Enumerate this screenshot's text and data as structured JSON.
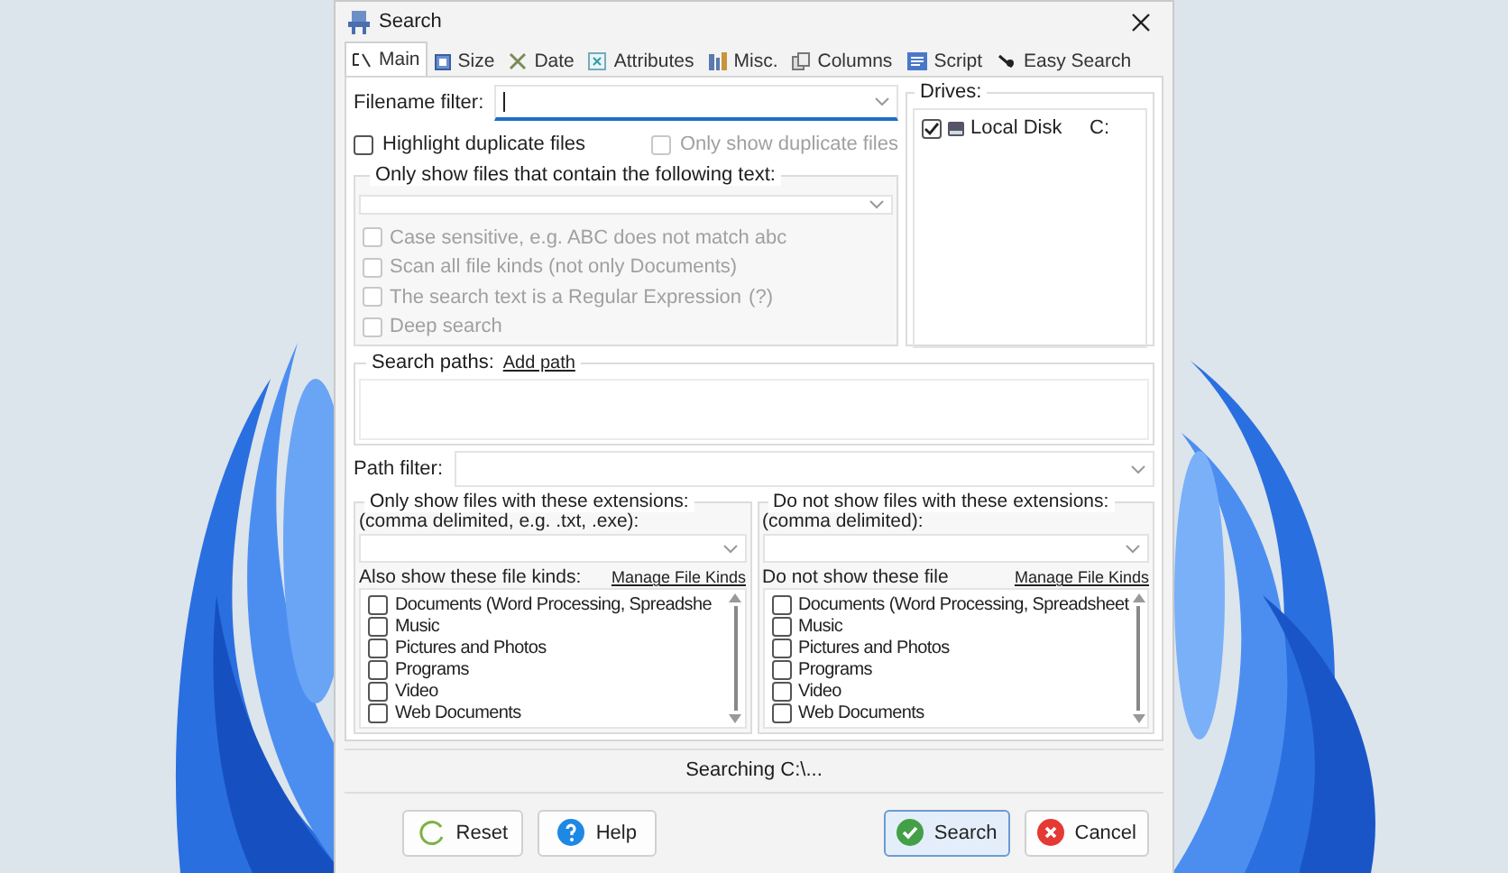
{
  "window": {
    "title": "Search"
  },
  "tabs": [
    {
      "label": "Main",
      "selected": true
    },
    {
      "label": "Size",
      "selected": false
    },
    {
      "label": "Date",
      "selected": false
    },
    {
      "label": "Attributes",
      "selected": false
    },
    {
      "label": "Misc.",
      "selected": false
    },
    {
      "label": "Columns",
      "selected": false
    },
    {
      "label": "Script",
      "selected": false
    },
    {
      "label": "Easy Search",
      "selected": false
    }
  ],
  "filename_filter": {
    "label": "Filename filter:",
    "focused": true
  },
  "duplicates": [
    {
      "label": "Highlight duplicate files",
      "checked": false,
      "disabled": false
    },
    {
      "label": "Only show duplicate files",
      "checked": false,
      "disabled": true
    }
  ],
  "text_group": {
    "title": "Only show files that contain the following text:",
    "options": [
      {
        "label": "Case sensitive, e.g. ABC does not match abc",
        "checked": false,
        "disabled": true
      },
      {
        "label": "Scan all file kinds (not only Documents)",
        "checked": false,
        "disabled": true
      },
      {
        "label": "The search text is a Regular Expression",
        "help": "(?)",
        "checked": false,
        "disabled": true
      },
      {
        "label": "Deep search",
        "checked": false,
        "disabled": true
      }
    ]
  },
  "drives": {
    "title": "Drives:",
    "items": [
      {
        "name": "Local Disk",
        "letter": "C:",
        "checked": true
      }
    ]
  },
  "search_paths": {
    "title": "Search paths:",
    "link": "Add path"
  },
  "path_filter": {
    "label": "Path filter:"
  },
  "extension_panels": [
    {
      "title": "Only show files with these extensions:",
      "hint": "(comma delimited, e.g. .txt, .exe):",
      "kinds_label": "Also show these file kinds:",
      "link": "Manage File Kinds",
      "kinds": [
        {
          "label": "Documents (Word Processing, Spreadshe",
          "checked": false
        },
        {
          "label": "Music",
          "checked": false
        },
        {
          "label": "Pictures and Photos",
          "checked": false
        },
        {
          "label": "Programs",
          "checked": false
        },
        {
          "label": "Video",
          "checked": false
        },
        {
          "label": "Web Documents",
          "checked": false
        }
      ]
    },
    {
      "title": "Do not show files with these extensions:",
      "hint": "(comma delimited):",
      "kinds_label": "Do not show these file",
      "link": "Manage File Kinds",
      "kinds": [
        {
          "label": "Documents (Word Processing, Spreadsheet",
          "checked": false
        },
        {
          "label": "Music",
          "checked": false
        },
        {
          "label": "Pictures and Photos",
          "checked": false
        },
        {
          "label": "Programs",
          "checked": false
        },
        {
          "label": "Video",
          "checked": false
        },
        {
          "label": "Web Documents",
          "checked": false
        }
      ]
    }
  ],
  "status": "Searching C:\\...",
  "buttons": [
    {
      "label": "Reset",
      "kind": "reset",
      "primary": false
    },
    {
      "label": "Help",
      "kind": "help",
      "primary": false
    },
    {
      "label": "Search",
      "kind": "search",
      "primary": true
    },
    {
      "label": "Cancel",
      "kind": "cancel",
      "primary": false
    }
  ]
}
